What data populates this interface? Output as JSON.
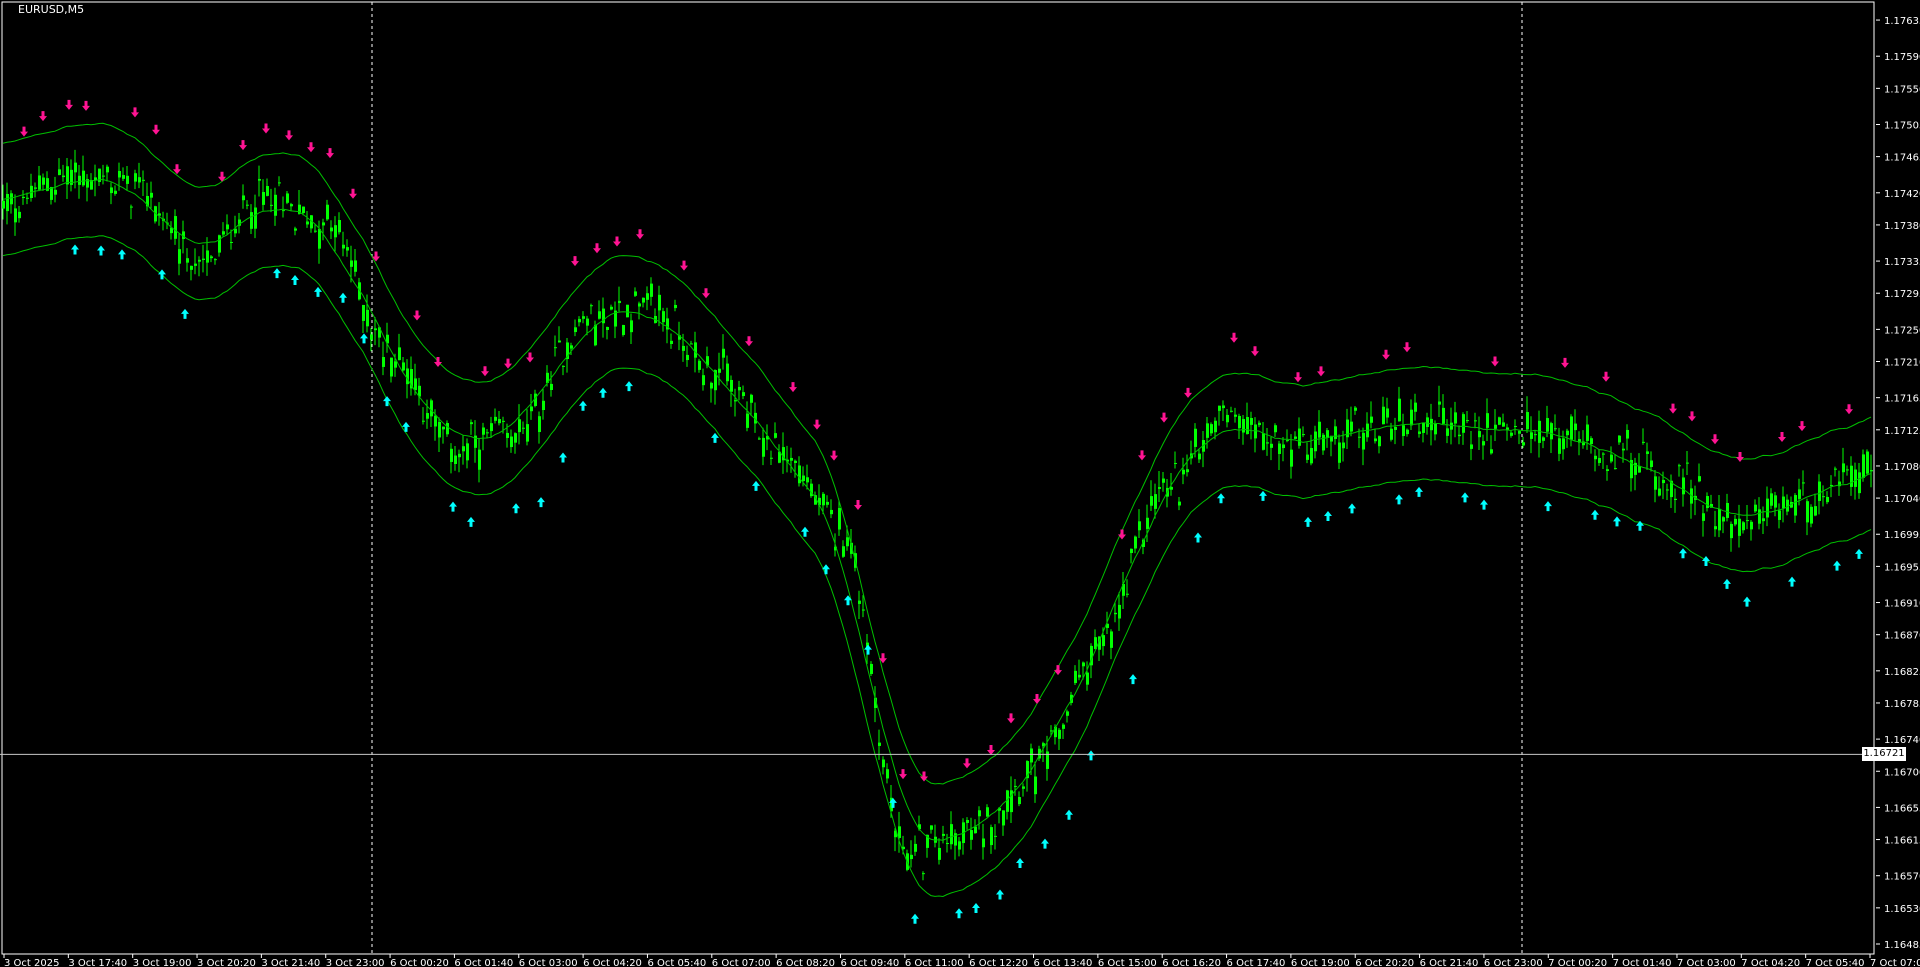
{
  "window": {
    "symbol_title": "EURUSD,M5"
  },
  "colors": {
    "background": "#000000",
    "candle": "#00ff00",
    "band": "#00c000",
    "arrow_down": "#ff1493",
    "arrow_up": "#00ffff",
    "axis": "#ffffff",
    "grid_dashed": "#ffffff",
    "price_line": "#c8c8c8"
  },
  "price_axis": {
    "ticks": [
      "1.17635",
      "1.17590",
      "1.17550",
      "1.17505",
      "1.17465",
      "1.17420",
      "1.17380",
      "1.17335",
      "1.17295",
      "1.17250",
      "1.17210",
      "1.17165",
      "1.17125",
      "1.17080",
      "1.17040",
      "1.16995",
      "1.16955",
      "1.16910",
      "1.16870",
      "1.16825",
      "1.16785",
      "1.16740",
      "1.16700",
      "1.16655",
      "1.16615",
      "1.16570",
      "1.16530",
      "1.16485"
    ],
    "current_price": "1.16721"
  },
  "time_axis": {
    "labels": [
      "3 Oct 2025",
      "3 Oct 17:40",
      "3 Oct 19:00",
      "3 Oct 20:20",
      "3 Oct 21:40",
      "3 Oct 23:00",
      "6 Oct 00:20",
      "6 Oct 01:40",
      "6 Oct 03:00",
      "6 Oct 04:20",
      "6 Oct 05:40",
      "6 Oct 07:00",
      "6 Oct 08:20",
      "6 Oct 09:40",
      "6 Oct 11:00",
      "6 Oct 12:20",
      "6 Oct 13:40",
      "6 Oct 15:00",
      "6 Oct 16:20",
      "6 Oct 17:40",
      "6 Oct 19:00",
      "6 Oct 20:20",
      "6 Oct 21:40",
      "6 Oct 23:00",
      "7 Oct 00:20",
      "7 Oct 01:40",
      "7 Oct 03:00",
      "7 Oct 04:20",
      "7 Oct 05:40",
      "7 Oct 07:00"
    ]
  },
  "chart_data": {
    "type": "line",
    "symbol": "EURUSD",
    "timeframe": "M5",
    "x": [
      "3 Oct 2025",
      "3 Oct 17:40",
      "3 Oct 19:00",
      "3 Oct 20:20",
      "3 Oct 21:40",
      "3 Oct 23:00",
      "6 Oct 00:20",
      "6 Oct 01:40",
      "6 Oct 03:00",
      "6 Oct 04:20",
      "6 Oct 05:40",
      "6 Oct 07:00",
      "6 Oct 08:20",
      "6 Oct 09:40",
      "6 Oct 11:00",
      "6 Oct 12:20",
      "6 Oct 13:40",
      "6 Oct 15:00",
      "6 Oct 16:20",
      "6 Oct 17:40",
      "6 Oct 19:00",
      "6 Oct 20:20",
      "6 Oct 21:40",
      "6 Oct 23:00",
      "7 Oct 00:20",
      "7 Oct 01:40",
      "7 Oct 03:00",
      "7 Oct 04:20",
      "7 Oct 05:40",
      "7 Oct 07:00"
    ],
    "series": [
      {
        "values": [
          1.174,
          1.1744,
          1.1743,
          1.1733,
          1.1741,
          1.1738,
          1.1722,
          1.171,
          1.1712,
          1.1726,
          1.1728,
          1.172,
          1.171,
          1.17,
          1.166,
          1.1662,
          1.167,
          1.1685,
          1.1705,
          1.1715,
          1.171,
          1.1712,
          1.1714,
          1.1712,
          1.1712,
          1.171,
          1.1706,
          1.17,
          1.1704,
          1.1707
        ]
      }
    ],
    "ylim": [
      1.16485,
      1.1765
    ],
    "current_price": 1.16721,
    "grid": false
  }
}
